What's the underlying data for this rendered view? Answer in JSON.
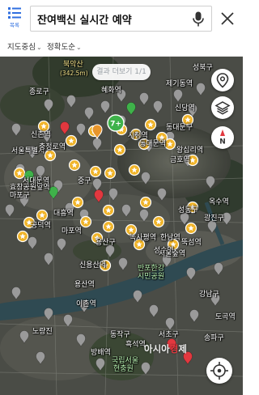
{
  "header": {
    "list_label": "목록",
    "search_value": "잔여백신 실시간 예약",
    "icons": {
      "list": "list-icon",
      "mic": "mic-icon",
      "close": "close-icon"
    }
  },
  "filters": [
    {
      "label": "지도중심",
      "icon": "chevron-down-icon"
    },
    {
      "label": "정확도순",
      "icon": "chevron-down-icon"
    }
  ],
  "map": {
    "result_chip": "결과 더보기 1/1",
    "labels": [
      "북악산",
      "(342.5m)",
      "성북구",
      "종로구",
      "동대문구",
      "중구",
      "용산구",
      "성동구",
      "광진구",
      "서울특별시",
      "마포구",
      "동작구",
      "강남구",
      "서초구",
      "송파구",
      "반포한강",
      "시민공원",
      "성수역",
      "옥수역",
      "신용산역",
      "녹사평역",
      "용산역",
      "한남역",
      "뚝섬역",
      "서울숲역",
      "금호역",
      "왕십리역",
      "국립서울",
      "현충원",
      "흑석역",
      "이촌역",
      "효창공원앞역",
      "충정로역",
      "시청역",
      "동대문역",
      "제기동역",
      "혜화역",
      "신당역",
      "노량진",
      "공덕역",
      "마포역",
      "대흥역",
      "신촌역",
      "서대문역",
      "방배역",
      "도곡역"
    ],
    "watermark": {
      "main": "아시아",
      "accent": "경",
      "tail": "제"
    },
    "markers": {
      "yellow_star": 34,
      "red_pin": 4,
      "green_pin": 3,
      "grey_pin": 58,
      "green_badge_count": "7+"
    },
    "colors": {
      "star_marker": "#f0b429",
      "red_marker": "#e2383f",
      "green_marker": "#3fb24a",
      "grey_marker": "#9a9a9a",
      "river": "#2f4a52",
      "accent_blue": "#2f6fe0"
    }
  },
  "controls": {
    "location": "location-icon",
    "layers": "layers-icon",
    "compass": "compass-icon",
    "compass_label": "N",
    "gps": "gps-icon"
  }
}
